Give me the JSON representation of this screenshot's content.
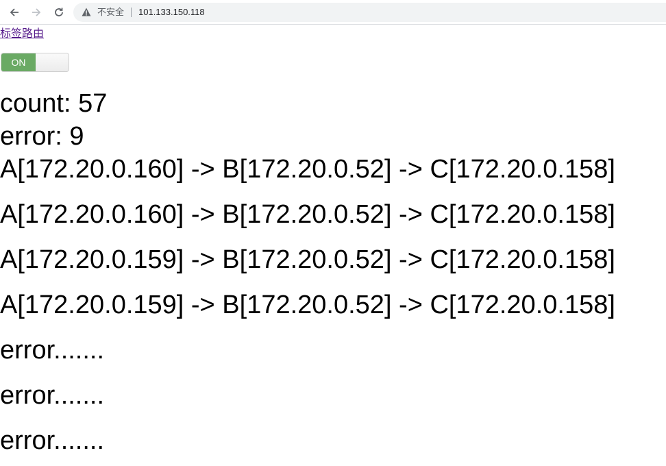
{
  "browser": {
    "security_label": "不安全",
    "url": "101.133.150.118",
    "icons": [
      "back-arrow-icon",
      "forward-arrow-icon",
      "reload-icon",
      "warning-icon"
    ]
  },
  "page": {
    "link_text": "标签路由",
    "toggle": {
      "label": "ON",
      "state": "on",
      "on_color": "#6aaa64"
    },
    "count": "count: 57",
    "error": "error: 9",
    "lines": [
      "A[172.20.0.160] -> B[172.20.0.52] -> C[172.20.0.158]",
      "A[172.20.0.160] -> B[172.20.0.52] -> C[172.20.0.158]",
      "A[172.20.0.159] -> B[172.20.0.52] -> C[172.20.0.158]",
      "A[172.20.0.159] -> B[172.20.0.52] -> C[172.20.0.158]",
      "error.......",
      "error.......",
      "error......."
    ]
  }
}
